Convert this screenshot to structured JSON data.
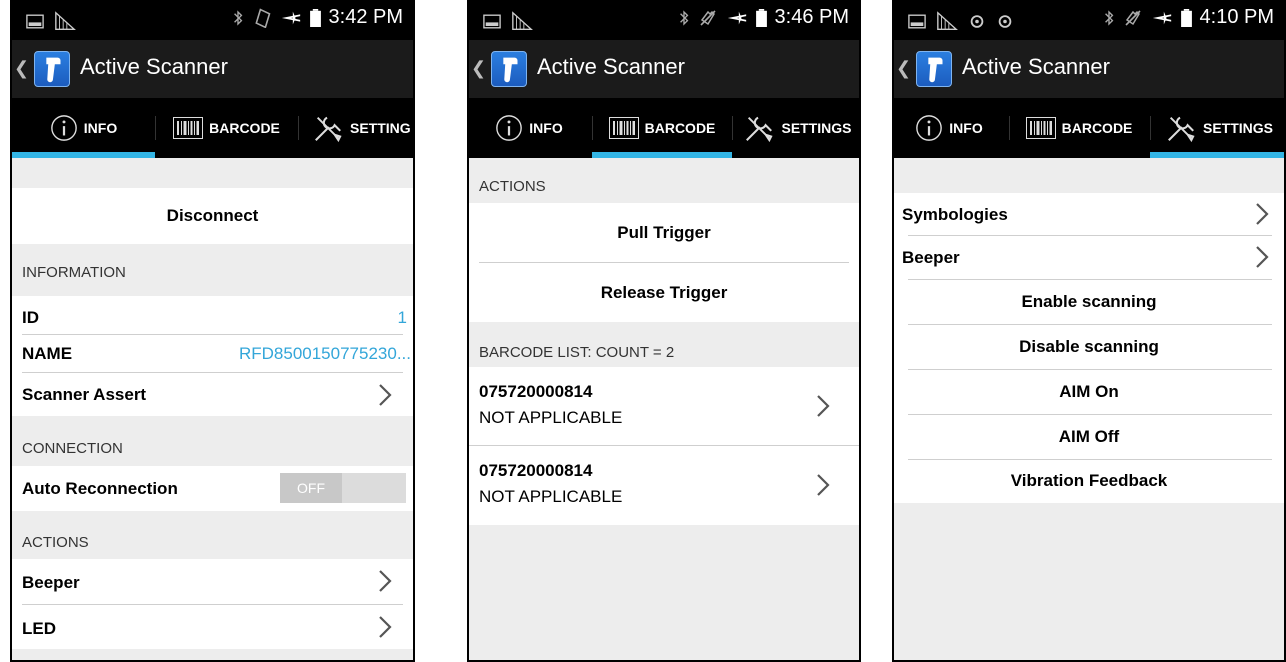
{
  "app": {
    "title": "Active Scanner"
  },
  "tabs": {
    "info": "INFO",
    "barcode": "BARCODE",
    "settings": "SETTINGS",
    "settings_clipped": "SETTING"
  },
  "status": {
    "time1": "3:42 PM",
    "time2": "3:46 PM",
    "time3": "4:10 PM"
  },
  "info": {
    "disconnect": "Disconnect",
    "information_header": "INFORMATION",
    "id_label": "ID",
    "id_value": "1",
    "name_label": "NAME",
    "name_value": "RFD8500150775230...",
    "scanner_assert": "Scanner Assert",
    "connection_header": "CONNECTION",
    "auto_reconnection": "Auto Reconnection",
    "toggle_state": "OFF",
    "actions_header": "ACTIONS",
    "beeper": "Beeper",
    "led": "LED"
  },
  "barcode": {
    "actions_header": "ACTIONS",
    "pull_trigger": "Pull Trigger",
    "release_trigger": "Release Trigger",
    "list_header": "BARCODE LIST: COUNT = 2",
    "items": [
      {
        "code": "075720000814",
        "type": "NOT APPLICABLE"
      },
      {
        "code": "075720000814",
        "type": "NOT APPLICABLE"
      }
    ]
  },
  "settings": {
    "symbologies": "Symbologies",
    "beeper": "Beeper",
    "enable_scanning": "Enable scanning",
    "disable_scanning": "Disable scanning",
    "aim_on": "AIM On",
    "aim_off": "AIM Off",
    "vibration_feedback": "Vibration Feedback"
  },
  "colors": {
    "accent": "#33b5e5",
    "link": "#33a6d9",
    "background": "#ededed"
  }
}
